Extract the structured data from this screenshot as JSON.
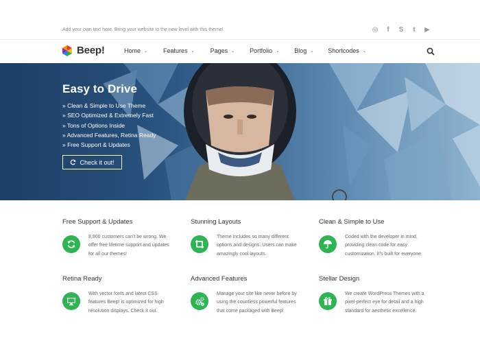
{
  "topbar": {
    "tagline": "Add your own text here. Bring your website to the new level with this theme!",
    "social": [
      {
        "icon": "dribbble-icon",
        "glyph": "◎"
      },
      {
        "icon": "facebook-icon",
        "glyph": "f"
      },
      {
        "icon": "skype-icon",
        "glyph": "S"
      },
      {
        "icon": "twitter-icon",
        "glyph": "t"
      },
      {
        "icon": "youtube-icon",
        "glyph": "▶"
      }
    ]
  },
  "nav": {
    "brand": "Beep!",
    "items": [
      "Home",
      "Features",
      "Pages",
      "Portfolio",
      "Blog",
      "Shortcodes"
    ]
  },
  "hero": {
    "title": "Easy to Drive",
    "bullets": [
      "» Clean & Simple to Use Theme",
      "» SEO Optimized & Extremely Fast",
      "» Tons of Options Inside",
      "» Advanced Features, Retina Ready",
      "» Free Support & Updates"
    ],
    "cta_label": "Check it out!"
  },
  "features": [
    {
      "title": "Free Support & Updates",
      "icon": "refresh-icon",
      "text": "8,900 customers can't be wrong. We offer free lifetime support and updates for all our themes!"
    },
    {
      "title": "Stunning Layouts",
      "icon": "crop-icon",
      "text": "Theme includes so many different options and designs. Users can make amazingly cool layouts."
    },
    {
      "title": "Clean & Simple to Use",
      "icon": "umbrella-icon",
      "text": "Coded with the developer in mind, providing clean code for easy customization. It's built for everyone."
    },
    {
      "title": "Retina Ready",
      "icon": "monitor-icon",
      "text": "With vector fonts and latest CSS features Beep! is optimized for high resolution displays. Check it out."
    },
    {
      "title": "Advanced Features",
      "icon": "gears-icon",
      "text": "Manage your site like never before by using the countless powerful features that come packaged with Beep!"
    },
    {
      "title": "Stellar Design",
      "icon": "gift-icon",
      "text": "We create WordPress Themes with a pixel-perfect eye for detail and a high standard for aesthetic excellence."
    }
  ],
  "colors": {
    "accent": "#2db554",
    "hero_dark": "#1e3f66",
    "text": "#333333"
  }
}
